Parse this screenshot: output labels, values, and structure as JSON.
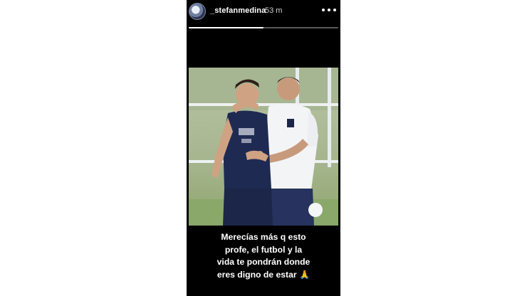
{
  "story": {
    "username": "_stefanmedina",
    "time_ago": "53 m",
    "progress": 0.5,
    "menu_icon": "more-horizontal-icon",
    "caption_lines": [
      "Merecías más q esto",
      "profe, el futbol y la",
      "vida te pondrán donde",
      "eres digno de estar 🙏"
    ]
  },
  "colors": {
    "background": "#ffffff",
    "story_background": "#000000",
    "text": "#ffffff"
  }
}
